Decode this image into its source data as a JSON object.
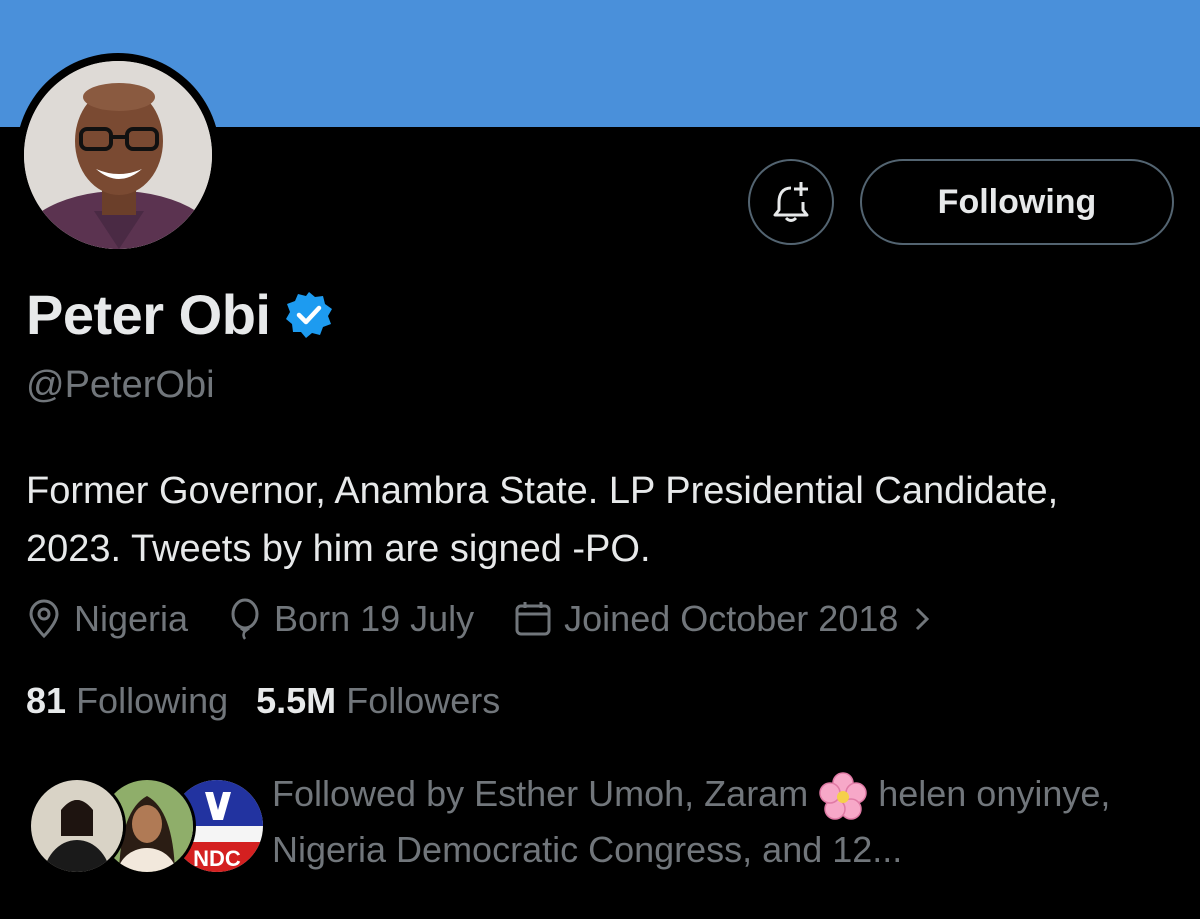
{
  "profile": {
    "name": "Peter Obi",
    "handle": "@PeterObi",
    "bio": "Former Governor, Anambra State. LP Presidential Candidate, 2023. Tweets by him are signed -PO.",
    "location": "Nigeria",
    "birthday": "Born 19 July",
    "joined": "Joined October 2018"
  },
  "actions": {
    "follow_label": "Following"
  },
  "stats": {
    "following_count": "81",
    "following_label": "Following",
    "followers_count": "5.5M",
    "followers_label": "Followers"
  },
  "followed_by": {
    "text_before": "Followed by Esther Umoh, Zaram",
    "text_after": "helen onyinye, Nigeria Democratic Congress, and 12..."
  },
  "colors": {
    "banner": "#4a90da",
    "verified": "#1d9bf0",
    "muted_text": "#71767b",
    "text": "#e7e9ea",
    "background": "#000000"
  },
  "icons": [
    "bell-plus-icon",
    "verified-badge-icon",
    "location-pin-icon",
    "balloon-icon",
    "calendar-icon",
    "chevron-right-icon",
    "cherry-blossom-icon"
  ]
}
